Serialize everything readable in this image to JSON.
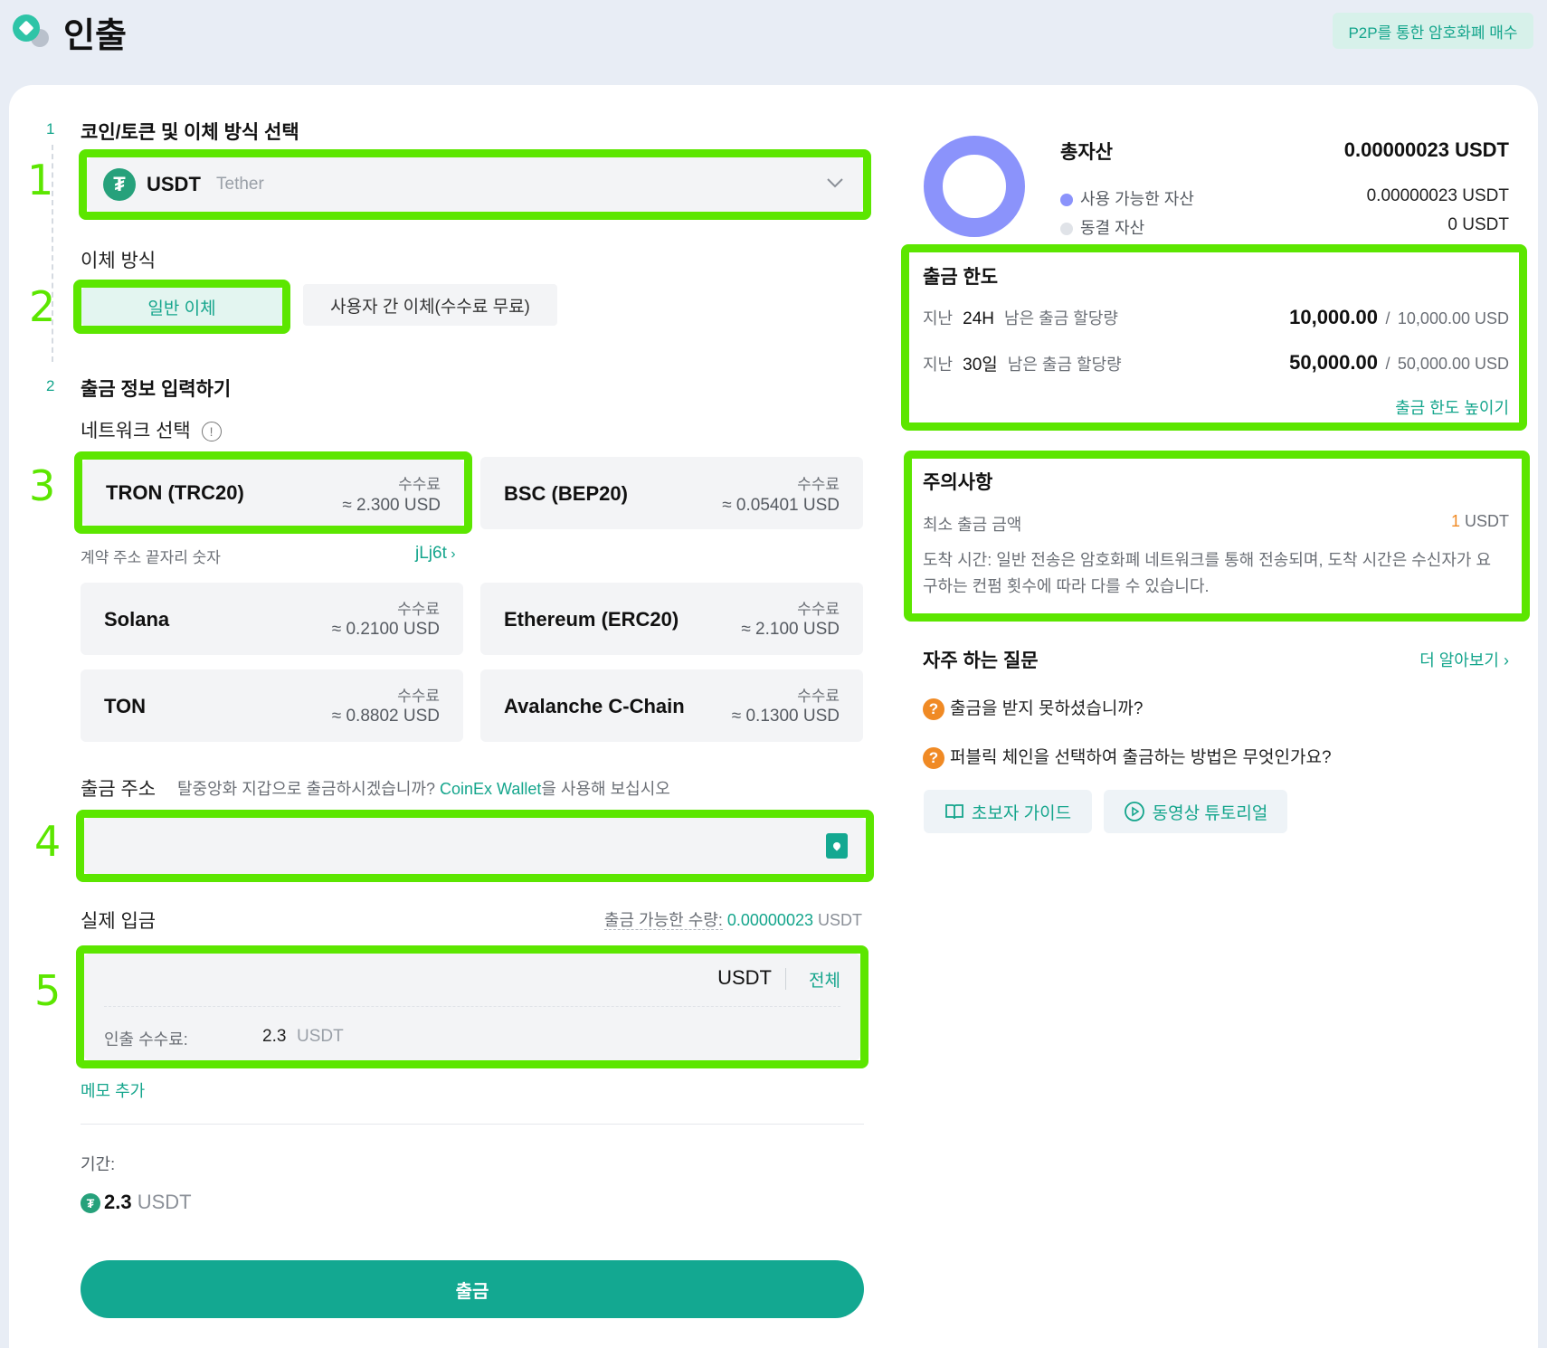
{
  "header": {
    "title": "인출",
    "p2p_button": "P2P를 통한 암호화폐 매수"
  },
  "annotations": [
    "1",
    "2",
    "3",
    "4",
    "5"
  ],
  "step1": {
    "number": "1",
    "title": "코인/토큰 및 이체 방식 선택",
    "coin": {
      "symbol": "USDT",
      "name": "Tether",
      "icon": "tether-icon"
    },
    "transfer_label": "이체 방식",
    "transfer_options": [
      "일반 이체",
      "사용자 간 이체(수수료 무료)"
    ]
  },
  "step2": {
    "number": "2",
    "title": "출금 정보 입력하기",
    "network_label": "네트워크 선택",
    "fee_label": "수수료",
    "networks": [
      {
        "name": "TRON (TRC20)",
        "fee": "≈ 2.300 USD"
      },
      {
        "name": "BSC (BEP20)",
        "fee": "≈ 0.05401 USD"
      },
      {
        "name": "Solana",
        "fee": "≈ 0.2100 USD"
      },
      {
        "name": "Ethereum (ERC20)",
        "fee": "≈ 2.100 USD"
      },
      {
        "name": "TON",
        "fee": "≈ 0.8802 USD"
      },
      {
        "name": "Avalanche C-Chain",
        "fee": "≈ 0.1300 USD"
      }
    ],
    "contract_label": "계약 주소 끝자리 숫자",
    "contract_value": "jLj6t",
    "address_label": "출금 주소",
    "address_hint_prefix": "탈중앙화 지갑으로 출금하시겠습니까?",
    "address_hint_link": "CoinEx Wallet",
    "address_hint_suffix": "을 사용해 보십시오",
    "actual_label": "실제 입금",
    "available_label": "출금 가능한 수량:",
    "available_value": "0.00000023",
    "available_unit": "USDT",
    "amount_unit": "USDT",
    "all_button": "전체",
    "fee_row_label": "인출 수수료:",
    "fee_row_value": "2.3",
    "fee_row_unit": "USDT",
    "memo_link": "메모 추가",
    "period_label": "기간:",
    "total_value": "2.3",
    "total_unit": "USDT",
    "submit_label": "출금"
  },
  "assets": {
    "title": "총자산",
    "total": "0.00000023 USDT",
    "available_label": "사용 가능한 자산",
    "available_value": "0.00000023 USDT",
    "frozen_label": "동결 자산",
    "frozen_value": "0 USDT",
    "available_color": "#8b93fb",
    "frozen_color": "#e0e3e8"
  },
  "limits": {
    "title": "출금 한도",
    "row1_prefix": "지난",
    "row1_period": "24H",
    "row1_suffix": "남은 출금 할당량",
    "row1_value": "10,000.00",
    "row1_total": "10,000.00 USD",
    "row2_prefix": "지난",
    "row2_period": "30일",
    "row2_suffix": "남은 출금 할당량",
    "row2_value": "50,000.00",
    "row2_total": "50,000.00 USD",
    "separator": "/",
    "raise_link": "출금 한도 높이기"
  },
  "notice": {
    "title": "주의사항",
    "min_label": "최소 출금 금액",
    "min_value": "1",
    "min_unit": "USDT",
    "arrival_text": "도착 시간: 일반 전송은 암호화폐 네트워크를 통해 전송되며, 도착 시간은 수신자가 요구하는 컨펌 횟수에 따라 다를 수 있습니다."
  },
  "faq": {
    "title": "자주 하는 질문",
    "more_link": "더 알아보기",
    "questions": [
      "출금을 받지 못하셨습니까?",
      "퍼블릭 체인을 선택하여 출금하는 방법은 무엇인가요?"
    ],
    "guide_button": "초보자 가이드",
    "video_button": "동영상 튜토리얼"
  },
  "colors": {
    "accent": "#14a58c",
    "highlight": "#5ce600",
    "button": "#13a891"
  }
}
